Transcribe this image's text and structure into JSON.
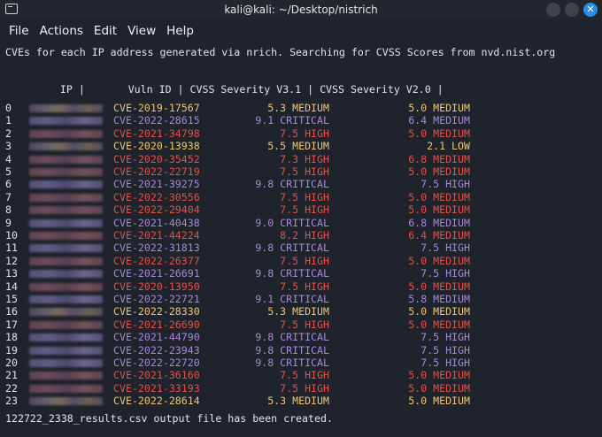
{
  "window": {
    "title": "kali@kali: ~/Desktop/nistrich",
    "close_glyph": "✕"
  },
  "menu": [
    "File",
    "Actions",
    "Edit",
    "View",
    "Help"
  ],
  "intro": "CVEs for each IP address generated via nrich. Searching for CVSS Scores from nvd.nist.org",
  "table_header": "    IP |       Vuln ID | CVSS Severity V3.1 | CVSS Severity V2.0 |",
  "rows": [
    {
      "idx": "0",
      "cve": "CVE-2019-17567",
      "v31": "5.3 MEDIUM",
      "v20": "5.0 MEDIUM",
      "cls": "med",
      "ip": "blur-1"
    },
    {
      "idx": "1",
      "cve": "CVE-2022-28615",
      "v31": "9.1 CRITICAL",
      "v20": "6.4 MEDIUM",
      "cls": "crit",
      "ip": "blur-2"
    },
    {
      "idx": "2",
      "cve": "CVE-2021-34798",
      "v31": "7.5 HIGH",
      "v20": "5.0 MEDIUM",
      "cls": "high",
      "ip": "blur-3"
    },
    {
      "idx": "3",
      "cve": "CVE-2020-13938",
      "v31": "5.5 MEDIUM",
      "v20": "2.1 LOW",
      "cls": "med",
      "ip": "blur-1"
    },
    {
      "idx": "4",
      "cve": "CVE-2020-35452",
      "v31": "7.3 HIGH",
      "v20": "6.8 MEDIUM",
      "cls": "high",
      "ip": "blur-3"
    },
    {
      "idx": "5",
      "cve": "CVE-2022-22719",
      "v31": "7.5 HIGH",
      "v20": "5.0 MEDIUM",
      "cls": "high",
      "ip": "blur-3"
    },
    {
      "idx": "6",
      "cve": "CVE-2021-39275",
      "v31": "9.8 CRITICAL",
      "v20": "7.5 HIGH",
      "cls": "crit",
      "ip": "blur-2"
    },
    {
      "idx": "7",
      "cve": "CVE-2022-30556",
      "v31": "7.5 HIGH",
      "v20": "5.0 MEDIUM",
      "cls": "high",
      "ip": "blur-3"
    },
    {
      "idx": "8",
      "cve": "CVE-2022-29404",
      "v31": "7.5 HIGH",
      "v20": "5.0 MEDIUM",
      "cls": "high",
      "ip": "blur-3"
    },
    {
      "idx": "9",
      "cve": "CVE-2021-40438",
      "v31": "9.0 CRITICAL",
      "v20": "6.8 MEDIUM",
      "cls": "crit",
      "ip": "blur-2"
    },
    {
      "idx": "10",
      "cve": "CVE-2021-44224",
      "v31": "8.2 HIGH",
      "v20": "6.4 MEDIUM",
      "cls": "high",
      "ip": "blur-3"
    },
    {
      "idx": "11",
      "cve": "CVE-2022-31813",
      "v31": "9.8 CRITICAL",
      "v20": "7.5 HIGH",
      "cls": "crit",
      "ip": "blur-2"
    },
    {
      "idx": "12",
      "cve": "CVE-2022-26377",
      "v31": "7.5 HIGH",
      "v20": "5.0 MEDIUM",
      "cls": "high",
      "ip": "blur-3"
    },
    {
      "idx": "13",
      "cve": "CVE-2021-26691",
      "v31": "9.8 CRITICAL",
      "v20": "7.5 HIGH",
      "cls": "crit",
      "ip": "blur-2"
    },
    {
      "idx": "14",
      "cve": "CVE-2020-13950",
      "v31": "7.5 HIGH",
      "v20": "5.0 MEDIUM",
      "cls": "high",
      "ip": "blur-3"
    },
    {
      "idx": "15",
      "cve": "CVE-2022-22721",
      "v31": "9.1 CRITICAL",
      "v20": "5.8 MEDIUM",
      "cls": "crit",
      "ip": "blur-2"
    },
    {
      "idx": "16",
      "cve": "CVE-2022-28330",
      "v31": "5.3 MEDIUM",
      "v20": "5.0 MEDIUM",
      "cls": "med",
      "ip": "blur-1"
    },
    {
      "idx": "17",
      "cve": "CVE-2021-26690",
      "v31": "7.5 HIGH",
      "v20": "5.0 MEDIUM",
      "cls": "high",
      "ip": "blur-3"
    },
    {
      "idx": "18",
      "cve": "CVE-2021-44790",
      "v31": "9.8 CRITICAL",
      "v20": "7.5 HIGH",
      "cls": "crit",
      "ip": "blur-2"
    },
    {
      "idx": "19",
      "cve": "CVE-2022-23943",
      "v31": "9.8 CRITICAL",
      "v20": "7.5 HIGH",
      "cls": "crit",
      "ip": "blur-2"
    },
    {
      "idx": "20",
      "cve": "CVE-2022-22720",
      "v31": "9.8 CRITICAL",
      "v20": "7.5 HIGH",
      "cls": "crit",
      "ip": "blur-2"
    },
    {
      "idx": "21",
      "cve": "CVE-2021-36160",
      "v31": "7.5 HIGH",
      "v20": "5.0 MEDIUM",
      "cls": "high",
      "ip": "blur-3"
    },
    {
      "idx": "22",
      "cve": "CVE-2021-33193",
      "v31": "7.5 HIGH",
      "v20": "5.0 MEDIUM",
      "cls": "high",
      "ip": "blur-3"
    },
    {
      "idx": "23",
      "cve": "CVE-2022-28614",
      "v31": "5.3 MEDIUM",
      "v20": "5.0 MEDIUM",
      "cls": "med",
      "ip": "blur-1"
    }
  ],
  "footer": "122722_2338_results.csv output file has been created.",
  "colors": {
    "background": "#1f232b",
    "medium": "#f0c674",
    "high": "#e2524a",
    "critical": "#a58ad8",
    "accent_close": "#2b8de5"
  }
}
